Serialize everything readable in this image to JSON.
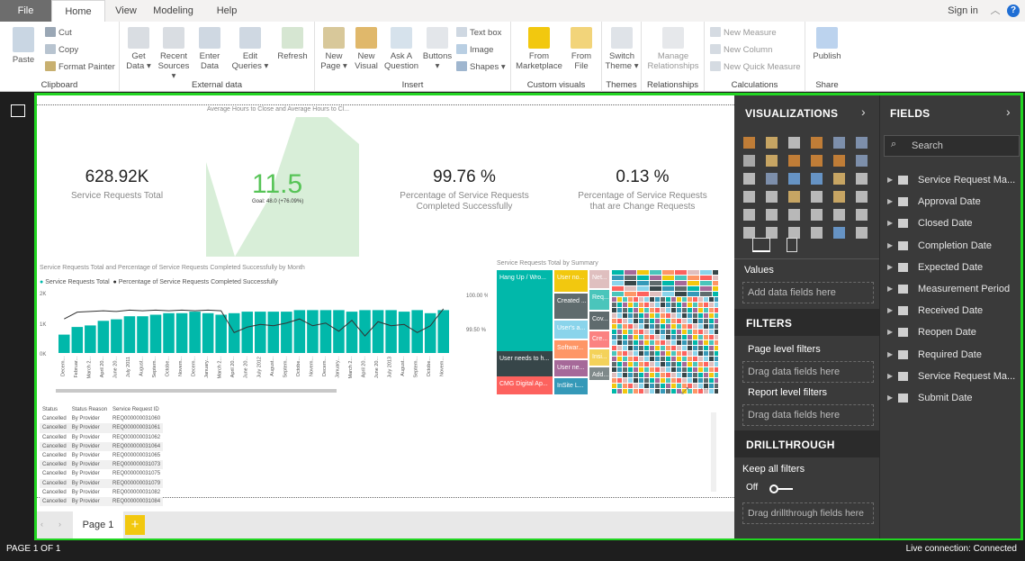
{
  "tabs": {
    "file": "File",
    "home": "Home",
    "view": "View",
    "modeling": "Modeling",
    "help": "Help"
  },
  "signin": "Sign in",
  "ribbon": {
    "paste": "Paste",
    "cut": "Cut",
    "copy": "Copy",
    "format_painter": "Format Painter",
    "clipboard": "Clipboard",
    "get_data": "Get",
    "get_data2": "Data ▾",
    "recent": "Recent",
    "recent2": "Sources ▾",
    "enter": "Enter",
    "enter2": "Data",
    "edit": "Edit",
    "edit2": "Queries ▾",
    "refresh": "Refresh",
    "external": "External data",
    "new_page": "New",
    "new_page2": "Page ▾",
    "new_visual": "New",
    "new_visual2": "Visual",
    "ask": "Ask A",
    "ask2": "Question",
    "buttons": "Buttons",
    "buttons2": "▾",
    "text_box": "Text box",
    "image": "Image",
    "shapes": "Shapes ▾",
    "insert": "Insert",
    "from_market": "From",
    "from_market2": "Marketplace",
    "from_file": "From",
    "from_file2": "File",
    "custom_visuals": "Custom visuals",
    "switch": "Switch",
    "switch2": "Theme ▾",
    "themes": "Themes",
    "manage": "Manage",
    "manage2": "Relationships",
    "relationships": "Relationships",
    "new_measure": "New Measure",
    "new_column": "New Column",
    "new_quick": "New Quick Measure",
    "calculations": "Calculations",
    "publish": "Publish",
    "share": "Share"
  },
  "report": {
    "area_title": "Average Hours to Close and Average Hours to Cl...",
    "kpi1_value": "628.92K",
    "kpi1_label": "Service Requests Total",
    "kpi2_value": "11.5",
    "kpi2_goal": "Goal: 48.0 (+76.09%)",
    "kpi3_value": "99.76 %",
    "kpi3_label1": "Percentage of Service Requests",
    "kpi3_label2": "Completed Successfully",
    "kpi4_value": "0.13 %",
    "kpi4_label1": "Percentage of Service Requests",
    "kpi4_label2": "that are Change Requests",
    "combo_title": "Service Requests Total and Percentage of Service Requests Completed Successfully by Month",
    "legend1": "Service Requests Total",
    "legend2": "Percentage of Service Requests Completed Successfully",
    "y_left": [
      "2K",
      "1K",
      "0K"
    ],
    "y_right": [
      "100.00 %",
      "99.50 %"
    ],
    "treemap_title": "Service Requests Total by Summary",
    "table_headers": [
      "Status",
      "Status Reason",
      "Service Request ID"
    ],
    "table_rows": [
      [
        "Cancelled",
        "By Provider",
        "REQ000000031060"
      ],
      [
        "Cancelled",
        "By Provider",
        "REQ000000031061"
      ],
      [
        "Cancelled",
        "By Provider",
        "REQ000000031062"
      ],
      [
        "Cancelled",
        "By Provider",
        "REQ000000031064"
      ],
      [
        "Cancelled",
        "By Provider",
        "REQ000000031065"
      ],
      [
        "Cancelled",
        "By Provider",
        "REQ000000031073"
      ],
      [
        "Cancelled",
        "By Provider",
        "REQ000000031075"
      ],
      [
        "Cancelled",
        "By Provider",
        "REQ000000031079"
      ],
      [
        "Cancelled",
        "By Provider",
        "REQ000000031082"
      ],
      [
        "Cancelled",
        "By Provider",
        "REQ000000031084"
      ]
    ],
    "page_tab": "Page 1",
    "add_page": "+"
  },
  "chart_data": {
    "type": "bar",
    "title": "Service Requests Total and Percentage of Service Requests Completed Successfully by Month",
    "categories": [
      "Decem...",
      "Februar...",
      "March 2...",
      "April 20...",
      "June 20...",
      "July 2011",
      "August...",
      "Septem...",
      "Octobe...",
      "Novem...",
      "Decem...",
      "January...",
      "March 2...",
      "April 20...",
      "June 20...",
      "July 2012",
      "August...",
      "Septem...",
      "Octobe...",
      "Novem...",
      "Decem...",
      "January...",
      "March 2...",
      "April 20...",
      "June 20...",
      "July 2013",
      "August...",
      "Septem...",
      "Octobe...",
      "Novem..."
    ],
    "series": [
      {
        "name": "Service Requests Total",
        "values": [
          600,
          850,
          900,
          1050,
          1100,
          1200,
          1200,
          1250,
          1300,
          1300,
          1350,
          1300,
          1250,
          1300,
          1350,
          1350,
          1350,
          1350,
          1400,
          1400,
          1400,
          1400,
          1350,
          1400,
          1400,
          1400,
          1350,
          1400,
          1300,
          1400
        ]
      },
      {
        "name": "Percentage of Service Requests Completed Successfully",
        "values": [
          99.8,
          99.9,
          99.91,
          99.92,
          99.91,
          99.93,
          99.92,
          99.93,
          99.92,
          99.93,
          99.92,
          99.93,
          99.92,
          99.6,
          99.68,
          99.72,
          99.7,
          99.74,
          99.8,
          99.7,
          99.74,
          99.62,
          99.78,
          99.55,
          99.76,
          99.7,
          99.72,
          99.6,
          99.7,
          99.95
        ]
      }
    ],
    "ylabel": "",
    "ylim": [
      0,
      2000
    ],
    "y2lim": [
      99.3,
      100.2
    ]
  },
  "treemap": [
    {
      "label": "Hang Up / Wro...",
      "color": "#01b8aa"
    },
    {
      "label": "User needs to h...",
      "color": "#374649"
    },
    {
      "label": "CMG Digital Ap...",
      "color": "#fd625e"
    },
    {
      "label": "User no...",
      "color": "#f2c80f"
    },
    {
      "label": "Created ...",
      "color": "#5f6b6d"
    },
    {
      "label": "User's a...",
      "color": "#8ad4eb"
    },
    {
      "label": "Softwar...",
      "color": "#fe9666"
    },
    {
      "label": "User ne...",
      "color": "#a66999"
    },
    {
      "label": "InSite L...",
      "color": "#3599b8"
    },
    {
      "label": "Net...",
      "color": "#dfbfbf"
    },
    {
      "label": "Req...",
      "color": "#4ac5bb"
    },
    {
      "label": "Cov...",
      "color": "#5f6b6d"
    },
    {
      "label": "Cre...",
      "color": "#fb8281"
    },
    {
      "label": "Insi...",
      "color": "#f4d25a"
    },
    {
      "label": "Add...",
      "color": "#7f898a"
    }
  ],
  "viz": {
    "title": "VISUALIZATIONS",
    "values": "Values",
    "values_well": "Add data fields here",
    "filters": "FILTERS",
    "page_filters": "Page level filters",
    "page_well": "Drag data fields here",
    "report_filters": "Report level filters",
    "report_well": "Drag data fields here",
    "drill": "DRILLTHROUGH",
    "keep": "Keep all filters",
    "off": "Off",
    "drill_well": "Drag drillthrough fields here"
  },
  "fields": {
    "title": "FIELDS",
    "search": "Search",
    "items": [
      "Service Request Ma...",
      "Approval Date",
      "Closed Date",
      "Completion Date",
      "Expected Date",
      "Measurement Period",
      "Received Date",
      "Reopen Date",
      "Required Date",
      "Service Request Ma...",
      "Submit Date"
    ]
  },
  "status": {
    "page": "PAGE 1 OF 1",
    "connection": "Live connection: Connected"
  },
  "colors": {
    "accent": "#01b8aa",
    "green_frame": "#21d521",
    "page_tab": "#f2c80f"
  }
}
